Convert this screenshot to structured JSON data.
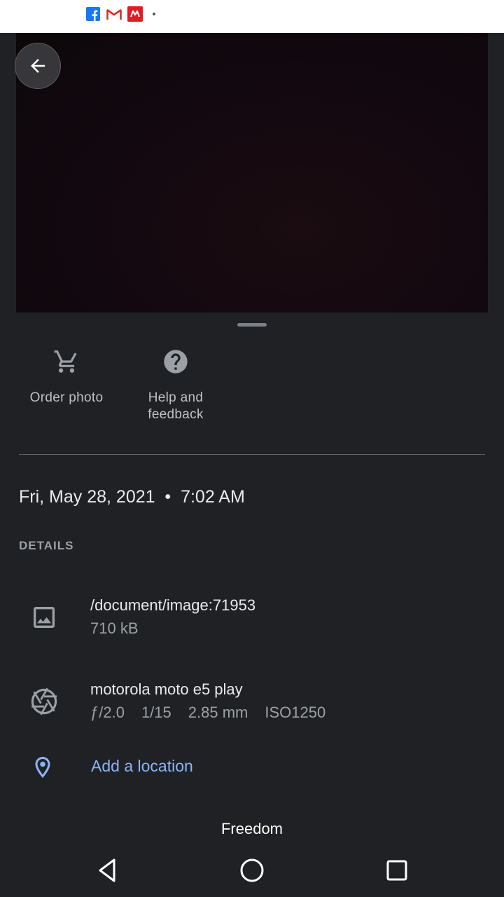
{
  "status_bar": {
    "notification_icons": [
      "facebook-icon",
      "gmail-icon",
      "myntra-icon",
      "more-dot-icon"
    ]
  },
  "viewer": {
    "back_icon": "arrow-back-icon"
  },
  "actions": [
    {
      "label": "Order photo",
      "icon": "cart-icon"
    },
    {
      "label": "Help and feedback",
      "icon": "help-circle-icon"
    }
  ],
  "info": {
    "datetime": "Fri, May 28, 2021  •  7:02 AM",
    "details_header": "DETAILS",
    "file": {
      "path": "/document/image:71953",
      "size": "710 kB",
      "icon": "image-icon"
    },
    "camera": {
      "model": "motorola moto e5 play",
      "specs": [
        "ƒ/2.0",
        "1/15",
        "2.85 mm",
        "ISO1250"
      ],
      "icon": "aperture-icon"
    },
    "location": {
      "link": "Add a location",
      "icon": "location-pin-icon"
    }
  },
  "caption": "Freedom",
  "nav": {
    "back": "nav-back-icon",
    "home": "nav-home-icon",
    "recents": "nav-recents-icon"
  },
  "colors": {
    "background": "#202124",
    "link": "#8ab4f8",
    "secondary_text": "#9aa0a6"
  }
}
